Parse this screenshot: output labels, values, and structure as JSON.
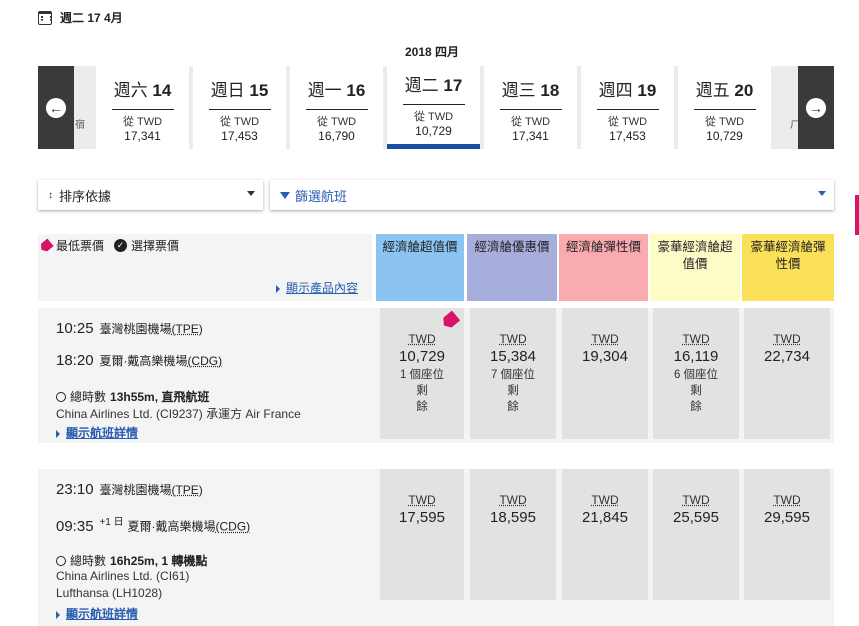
{
  "header": {
    "date_label": "週二 17 4月",
    "month_label": "2018 四月"
  },
  "date_strip": {
    "prev_icon": "arrow-left-circle",
    "next_icon": "arrow-right-circle",
    "left_fragment": "宿",
    "right_fragment": "ㄏ",
    "days": [
      {
        "weekday": "週六",
        "num": "14",
        "from": "從 TWD",
        "price": "17,341"
      },
      {
        "weekday": "週日",
        "num": "15",
        "from": "從 TWD",
        "price": "17,453"
      },
      {
        "weekday": "週一",
        "num": "16",
        "from": "從 TWD",
        "price": "16,790"
      },
      {
        "weekday": "週二",
        "num": "17",
        "from": "從 TWD",
        "price": "10,729"
      },
      {
        "weekday": "週三",
        "num": "18",
        "from": "從 TWD",
        "price": "17,341"
      },
      {
        "weekday": "週四",
        "num": "19",
        "from": "從 TWD",
        "price": "17,453"
      },
      {
        "weekday": "週五",
        "num": "20",
        "from": "從 TWD",
        "price": "10,729"
      }
    ],
    "selected_index": 3,
    "selected_color": "#1b4fa0"
  },
  "controls": {
    "sort_label": "排序依據",
    "filter_label": "篩選航班"
  },
  "legend": {
    "lowest_label": "最低票價",
    "selected_label": "選擇票價",
    "show_products": "顯示產品內容"
  },
  "cabins": [
    {
      "line1": "經濟艙超值價",
      "line2": "",
      "color": "#8bc4f0"
    },
    {
      "line1": "經濟艙優惠價",
      "line2": "",
      "color": "#a7aedb"
    },
    {
      "line1": "經濟艙彈性價",
      "line2": "",
      "color": "#f9abb0"
    },
    {
      "line1": "豪華經濟艙超",
      "line2": "值價",
      "color": "#fdfbc6"
    },
    {
      "line1": "豪華經濟艙彈",
      "line2": "性價",
      "color": "#fbe05a"
    }
  ],
  "flights": [
    {
      "dep_time": "10:25",
      "dep_airport": "臺灣桃園機場",
      "dep_code": "(TPE)",
      "arr_time": "18:20",
      "arr_plus": "",
      "arr_airport": "夏爾·戴高樂機場",
      "arr_code": "(CDG)",
      "duration_prefix": "總時數",
      "duration": "13h55m, 直飛航班",
      "carrier1": "China Airlines Ltd. (CI9237) 承運方 Air France",
      "carrier2": "",
      "details": "顯示航班詳情",
      "fares": [
        {
          "cur": "TWD",
          "amt": "10,729",
          "seats1": "1 個座位剩",
          "seats2": "餘",
          "lowest": true
        },
        {
          "cur": "TWD",
          "amt": "15,384",
          "seats1": "7 個座位剩",
          "seats2": "餘",
          "lowest": false
        },
        {
          "cur": "TWD",
          "amt": "19,304",
          "seats1": "",
          "seats2": "",
          "lowest": false
        },
        {
          "cur": "TWD",
          "amt": "16,119",
          "seats1": "6 個座位剩",
          "seats2": "餘",
          "lowest": false
        },
        {
          "cur": "TWD",
          "amt": "22,734",
          "seats1": "",
          "seats2": "",
          "lowest": false
        }
      ]
    },
    {
      "dep_time": "23:10",
      "dep_airport": "臺灣桃園機場",
      "dep_code": "(TPE)",
      "arr_time": "09:35",
      "arr_plus": "+1 日",
      "arr_airport": "夏爾·戴高樂機場",
      "arr_code": "(CDG)",
      "duration_prefix": "總時數",
      "duration": "16h25m, 1 轉機點",
      "carrier1": "China Airlines Ltd. (CI61)",
      "carrier2": "Lufthansa (LH1028)",
      "details": "顯示航班詳情",
      "fares": [
        {
          "cur": "TWD",
          "amt": "17,595",
          "seats1": "",
          "seats2": "",
          "lowest": false
        },
        {
          "cur": "TWD",
          "amt": "18,595",
          "seats1": "",
          "seats2": "",
          "lowest": false
        },
        {
          "cur": "TWD",
          "amt": "21,845",
          "seats1": "",
          "seats2": "",
          "lowest": false
        },
        {
          "cur": "TWD",
          "amt": "25,595",
          "seats1": "",
          "seats2": "",
          "lowest": false
        },
        {
          "cur": "TWD",
          "amt": "29,595",
          "seats1": "",
          "seats2": "",
          "lowest": false
        }
      ]
    }
  ]
}
